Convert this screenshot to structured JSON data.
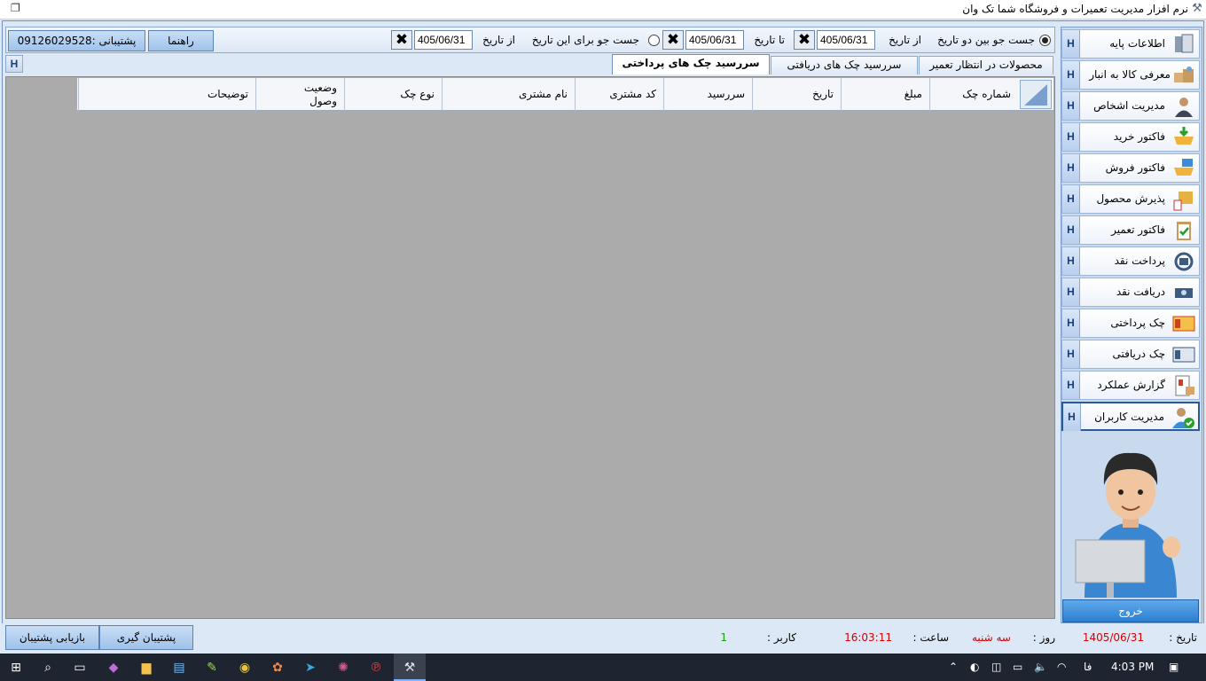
{
  "window": {
    "title": "نرم افزار مدیریت تعمیرات و فروشگاه شما   تک وان"
  },
  "sidebar": {
    "items": [
      {
        "label": "اطلاعات پایه",
        "h": "H",
        "icon": "database-book-icon"
      },
      {
        "label": "معرفی کالا به انبار",
        "h": "H",
        "icon": "warehouse-boxes-icon"
      },
      {
        "label": "مدیریت اشخاص",
        "h": "H",
        "icon": "person-icon"
      },
      {
        "label": "فاکتور خرید",
        "h": "H",
        "icon": "cart-download-icon"
      },
      {
        "label": "فاکتور فروش",
        "h": "H",
        "icon": "cart-sell-icon"
      },
      {
        "label": "پذیرش محصول",
        "h": "H",
        "icon": "product-box-icon"
      },
      {
        "label": "فاکتور تعمیر",
        "h": "H",
        "icon": "clipboard-check-icon"
      },
      {
        "label": "پرداخت نقد",
        "h": "H",
        "icon": "cash-pay-icon"
      },
      {
        "label": "دریافت نقد",
        "h": "H",
        "icon": "cash-receive-icon"
      },
      {
        "label": "چک پرداختی",
        "h": "H",
        "icon": "cheque-pay-icon"
      },
      {
        "label": "چک دریافتی",
        "h": "H",
        "icon": "cheque-receive-icon"
      },
      {
        "label": "گزارش عملکرد",
        "h": "H",
        "icon": "report-icon"
      },
      {
        "label": "مدیریت کاربران",
        "h": "H",
        "icon": "user-check-icon"
      }
    ],
    "exit_label": "خروج"
  },
  "search": {
    "option_between": "جست جو بین دو تاریخ",
    "option_for": "جست جو برای این تاریخ",
    "from_label": "از تاریخ",
    "to_label": "تا تاریخ",
    "from_date": "405/06/31",
    "to_date": "405/06/31",
    "single_from_label": "از تاریخ",
    "single_date": "405/06/31",
    "selected_option": "between"
  },
  "toolbar": {
    "help_label": "راهنما",
    "support_label": "پشتیبانی :09126029528"
  },
  "tabs": [
    {
      "label": "محصولات در انتظار تعمیر",
      "active": false
    },
    {
      "label": "سررسید چک های دریافتی",
      "active": false
    },
    {
      "label": "سررسید چک های پرداختی",
      "active": true
    }
  ],
  "tabs_h": "H",
  "grid": {
    "columns": [
      "شماره چک",
      "مبلغ",
      "تاریخ",
      "سررسید",
      "کد مشتری",
      "نام مشتری",
      "نوع چک",
      "وضعیت وصول",
      "توضیحات"
    ],
    "status_col_line1": "وضعیت",
    "status_col_line2": "وصول",
    "rows": []
  },
  "status": {
    "date_label": "تاریخ :",
    "date_value": "1405/06/31",
    "day_label": "روز :",
    "day_value": "سه شنبه",
    "time_label": "ساعت :",
    "time_value": "16:03:11",
    "user_label": "کاربر :",
    "user_value": "1",
    "backup_label": "پشتیبان گیری",
    "restore_label": "بازیابی پشتیبان"
  },
  "taskbar": {
    "clock": "4:03 PM",
    "lang": "فا"
  },
  "colors": {
    "accent": "#2c7fcf",
    "grid_bg": "#ababab",
    "red_text": "#d40000",
    "green_text": "#1a9a1a"
  }
}
